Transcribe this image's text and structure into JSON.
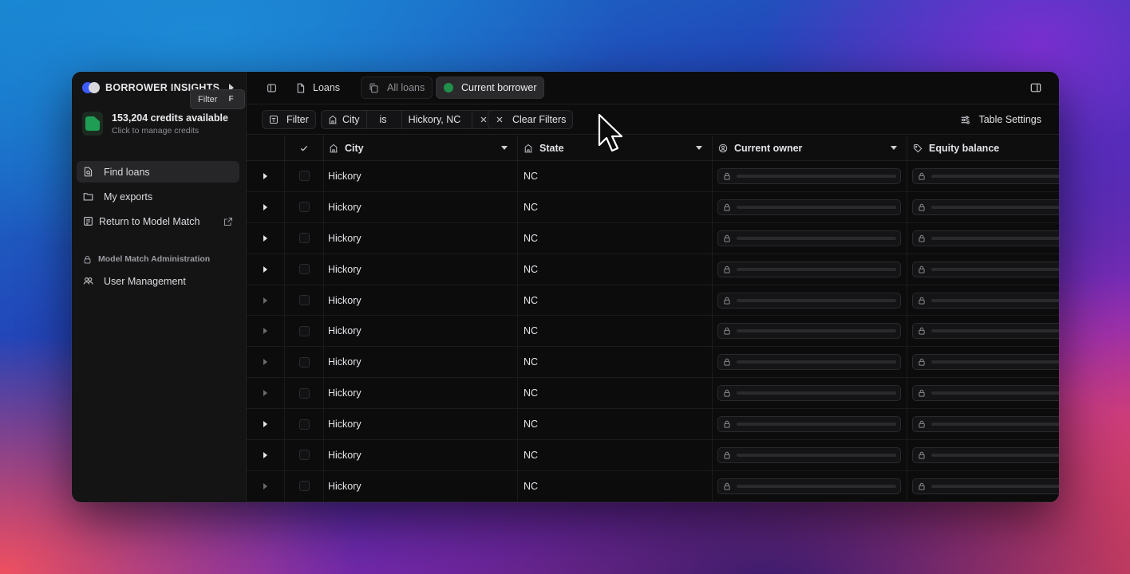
{
  "app": {
    "brand_title": "BORROWER INSIGHTS",
    "credits_main": "153,204 credits available",
    "credits_sub": "Click to manage credits"
  },
  "sidebar": {
    "items": [
      {
        "label": "Find loans",
        "icon": "file-search-icon",
        "active": true
      },
      {
        "label": "My exports",
        "icon": "folder-icon",
        "active": false
      },
      {
        "label": "Return to Model Match",
        "icon": "building-icon",
        "active": false
      }
    ],
    "section_label": "Model Match Administration",
    "admin_items": [
      {
        "label": "User Management",
        "icon": "users-icon"
      }
    ]
  },
  "topbar": {
    "loans_label": "Loans",
    "tabs": [
      {
        "label": "All loans",
        "active": false
      },
      {
        "label": "Current borrower",
        "active": true
      }
    ]
  },
  "tooltip": {
    "label": "Filter",
    "shortcut": "F"
  },
  "filterbar": {
    "filter_label": "Filter",
    "chip": {
      "field": "City",
      "operator": "is",
      "value": "Hickory, NC"
    },
    "clear_label": "Clear Filters",
    "table_settings_label": "Table Settings"
  },
  "table": {
    "columns": [
      "City",
      "State",
      "Current owner",
      "Equity balance"
    ],
    "rows": [
      {
        "city": "Hickory",
        "state": "NC"
      },
      {
        "city": "Hickory",
        "state": "NC"
      },
      {
        "city": "Hickory",
        "state": "NC"
      },
      {
        "city": "Hickory",
        "state": "NC"
      },
      {
        "city": "Hickory",
        "state": "NC"
      },
      {
        "city": "Hickory",
        "state": "NC"
      },
      {
        "city": "Hickory",
        "state": "NC"
      },
      {
        "city": "Hickory",
        "state": "NC"
      },
      {
        "city": "Hickory",
        "state": "NC"
      },
      {
        "city": "Hickory",
        "state": "NC"
      },
      {
        "city": "Hickory",
        "state": "NC"
      }
    ]
  },
  "colors": {
    "brand_blue": "#3b5bff",
    "accent_green": "#1f8f4a",
    "window_bg": "#0b0b0c",
    "sidebar_bg": "#141415"
  }
}
